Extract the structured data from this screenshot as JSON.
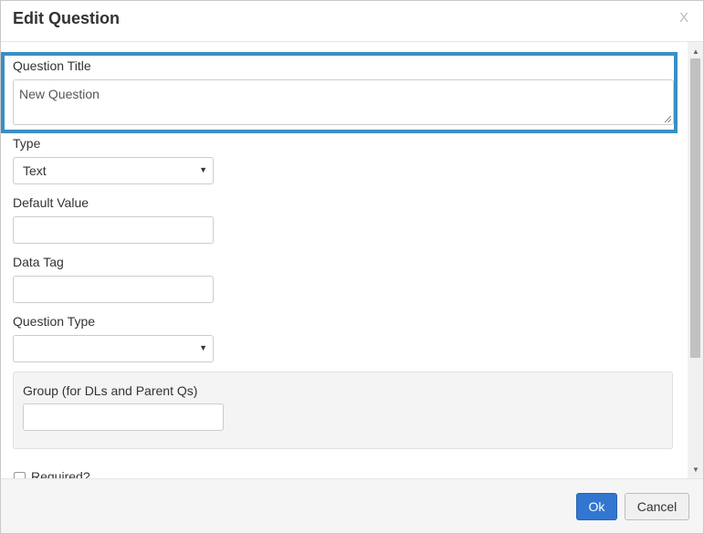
{
  "dialog": {
    "title": "Edit Question",
    "close_label": "X"
  },
  "form": {
    "question_title": {
      "label": "Question Title",
      "value": "New Question"
    },
    "type": {
      "label": "Type",
      "selected": "Text"
    },
    "default_value": {
      "label": "Default Value",
      "value": ""
    },
    "data_tag": {
      "label": "Data Tag",
      "value": ""
    },
    "question_type": {
      "label": "Question Type",
      "selected": ""
    },
    "group": {
      "label": "Group (for DLs and Parent Qs)",
      "value": ""
    },
    "required": {
      "label": "Required?",
      "checked": false
    }
  },
  "footer": {
    "ok_label": "Ok",
    "cancel_label": "Cancel"
  },
  "colors": {
    "highlight": "#3a8fc4",
    "primary_button": "#3276d1"
  }
}
